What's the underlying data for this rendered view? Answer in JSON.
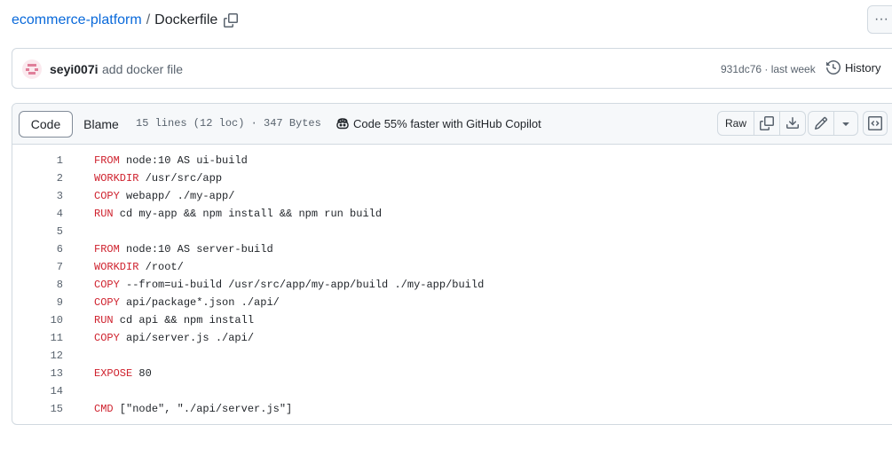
{
  "breadcrumb": {
    "repo": "ecommerce-platform",
    "separator": "/",
    "file": "Dockerfile",
    "copy_icon": "copy-icon"
  },
  "header": {
    "more_icon": "kebab-horizontal-icon",
    "more_label": "···"
  },
  "commit": {
    "avatar_icon": "identicon-avatar",
    "author": "seyi007i",
    "message": "add docker file",
    "sha_time": "931dc76 · last week",
    "history_label": "History",
    "history_icon": "history-icon"
  },
  "toolbar": {
    "code_tab": "Code",
    "blame_tab": "Blame",
    "stats": "15 lines (12 loc) · 347 Bytes",
    "copilot_icon": "copilot-icon",
    "copilot_text": "Code 55% faster with GitHub Copilot",
    "raw_label": "Raw",
    "copy_raw_icon": "copy-icon",
    "download_icon": "download-icon",
    "edit_icon": "pencil-icon",
    "dropdown_icon": "triangle-down-icon",
    "symbols_icon": "code-square-icon"
  },
  "colors": {
    "link": "#0969da",
    "keyword": "#cf222e",
    "muted": "#59636e",
    "border": "#d1d9e0"
  },
  "code": {
    "lines": [
      {
        "num": "1",
        "kw": "FROM",
        "text": " node:10 AS ui-build"
      },
      {
        "num": "2",
        "kw": "WORKDIR",
        "text": " /usr/src/app"
      },
      {
        "num": "3",
        "kw": "COPY",
        "text": " webapp/ ./my-app/"
      },
      {
        "num": "4",
        "kw": "RUN",
        "text": " cd my-app && npm install && npm run build"
      },
      {
        "num": "5",
        "kw": "",
        "text": ""
      },
      {
        "num": "6",
        "kw": "FROM",
        "text": " node:10 AS server-build"
      },
      {
        "num": "7",
        "kw": "WORKDIR",
        "text": " /root/"
      },
      {
        "num": "8",
        "kw": "COPY",
        "text": " --from=ui-build /usr/src/app/my-app/build ./my-app/build"
      },
      {
        "num": "9",
        "kw": "COPY",
        "text": " api/package*.json ./api/"
      },
      {
        "num": "10",
        "kw": "RUN",
        "text": " cd api && npm install"
      },
      {
        "num": "11",
        "kw": "COPY",
        "text": " api/server.js ./api/"
      },
      {
        "num": "12",
        "kw": "",
        "text": ""
      },
      {
        "num": "13",
        "kw": "EXPOSE",
        "text": " 80"
      },
      {
        "num": "14",
        "kw": "",
        "text": ""
      },
      {
        "num": "15",
        "kw": "CMD",
        "text": " [\"node\", \"./api/server.js\"]"
      }
    ]
  }
}
